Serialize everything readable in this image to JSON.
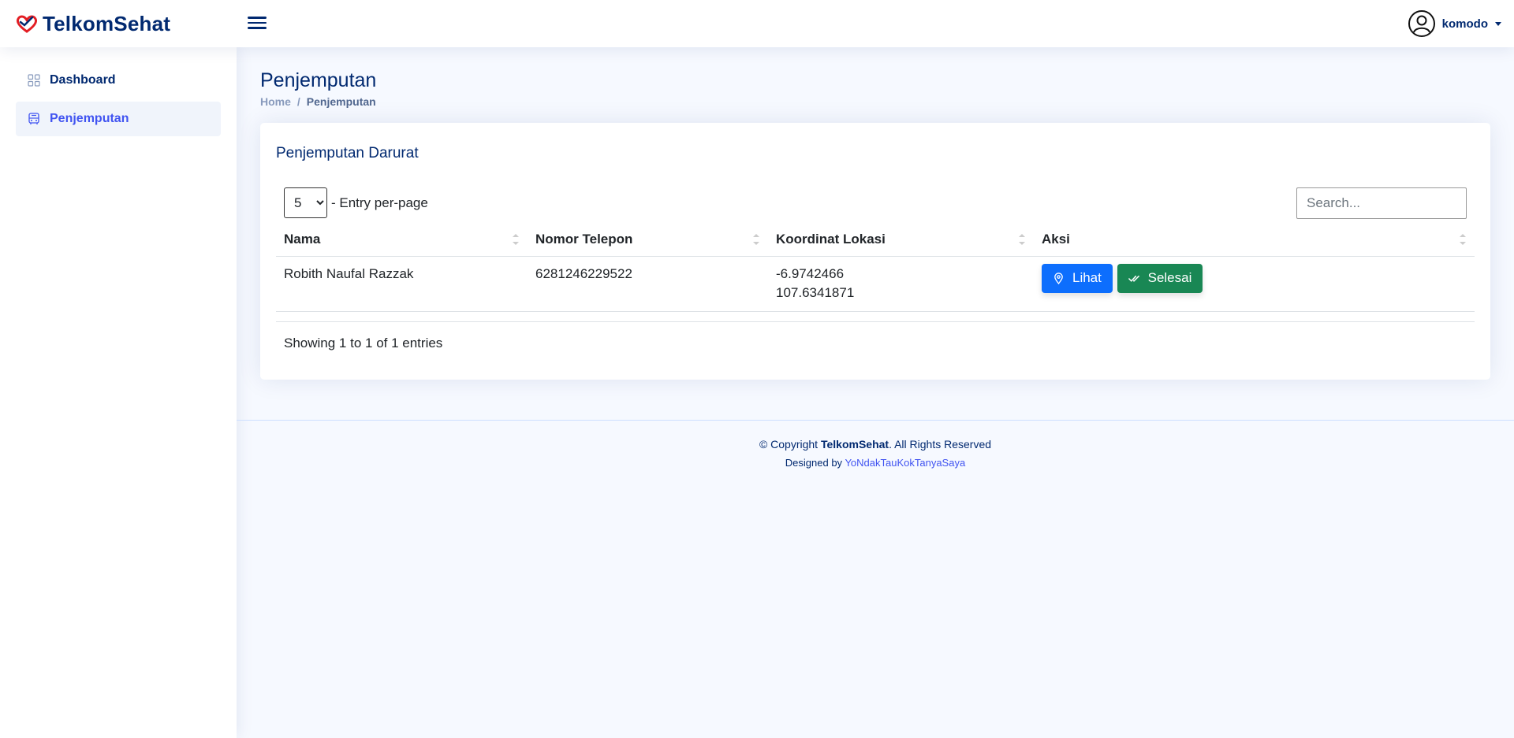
{
  "header": {
    "brand": "TelkomSehat",
    "user": "komodo"
  },
  "sidebar": {
    "items": [
      {
        "label": "Dashboard",
        "icon": "grid-icon",
        "active": false
      },
      {
        "label": "Penjemputan",
        "icon": "bus-icon",
        "active": true
      }
    ]
  },
  "page": {
    "title": "Penjemputan",
    "breadcrumb": {
      "home": "Home",
      "separator": "/",
      "current": "Penjemputan"
    }
  },
  "card": {
    "title": "Penjemputan Darurat",
    "entries_value": "5",
    "entries_label": "- Entry per-page",
    "search_placeholder": "Search...",
    "columns": [
      "Nama",
      "Nomor Telepon",
      "Koordinat Lokasi",
      "Aksi"
    ],
    "rows": [
      {
        "nama": "Robith Naufal Razzak",
        "telepon": "6281246229522",
        "lat": "-6.9742466",
        "lng": "107.6341871",
        "actions": {
          "view": "Lihat",
          "done": "Selesai"
        }
      }
    ],
    "showing": "Showing 1 to 1 of 1 entries"
  },
  "footer": {
    "copyright_prefix": "© Copyright",
    "copyright_brand": "TelkomSehat",
    "copyright_suffix": ". All Rights Reserved",
    "designed_by": "Designed by",
    "designer": "YoNdakTauKokTanyaSaya"
  },
  "colors": {
    "brand": "#012970",
    "accent": "#4154f1",
    "primary": "#0d6efd",
    "success": "#198754",
    "logo_red": "#e31e24"
  }
}
